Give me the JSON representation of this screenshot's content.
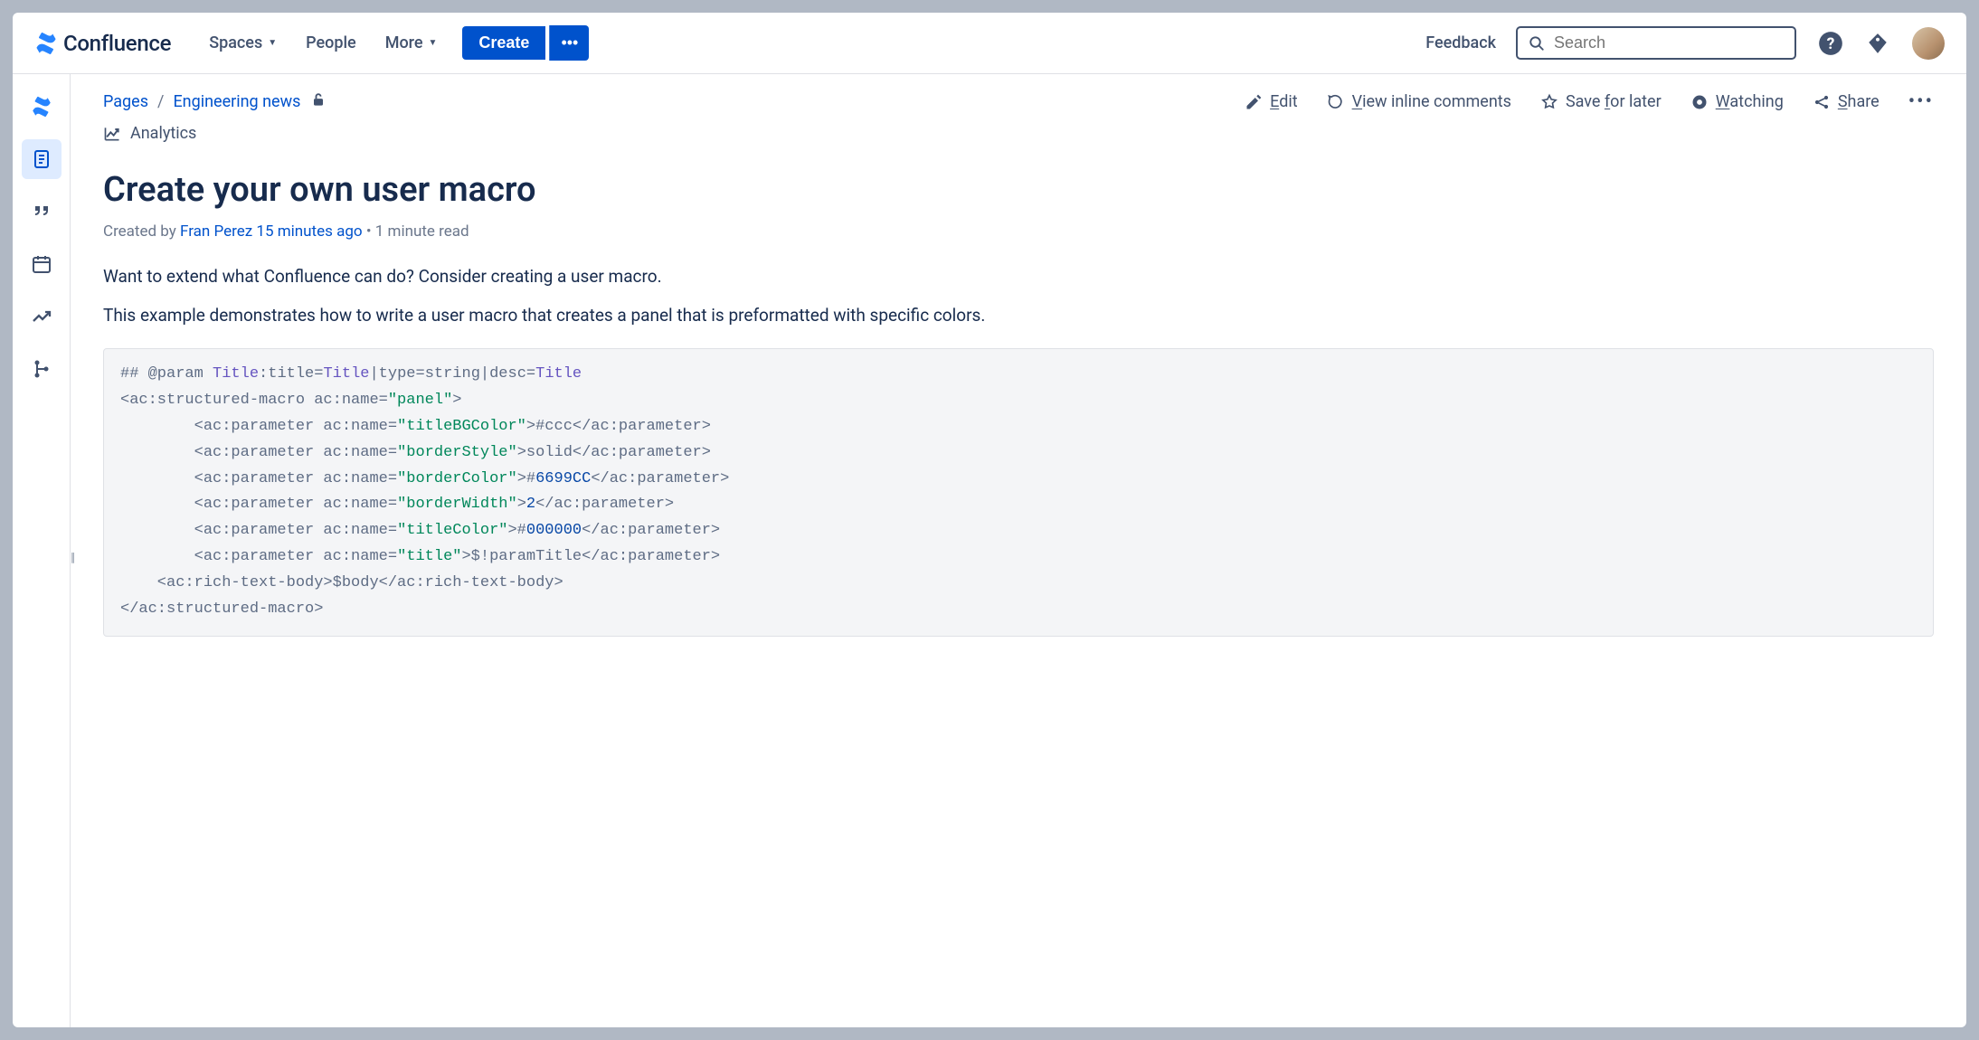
{
  "brand": {
    "name": "Confluence"
  },
  "nav": {
    "spaces": "Spaces",
    "people": "People",
    "more": "More",
    "create": "Create",
    "feedback": "Feedback",
    "search_placeholder": "Search"
  },
  "breadcrumb": {
    "pages": "Pages",
    "space": "Engineering news"
  },
  "toolbar": {
    "edit": "Edit",
    "view_inline": "View inline comments",
    "save_later": "Save for later",
    "watching": "Watching",
    "share": "Share",
    "analytics": "Analytics"
  },
  "page": {
    "title": "Create your own user macro",
    "byline_prefix": "Created by ",
    "author": "Fran Perez",
    "when": "15 minutes ago",
    "readtime": "1 minute read",
    "para1": "Want to extend what Confluence can do? Consider creating a user macro.",
    "para2": "This example demonstrates how to write a user macro that creates a panel that is preformatted with specific colors."
  },
  "code": {
    "l1_a": "## @param ",
    "l1_b": "Title",
    "l1_c": ":title=",
    "l1_d": "Title",
    "l1_e": "|type=string|desc=",
    "l1_f": "Title",
    "l2_a": "<ac:structured-macro ac:name=",
    "l2_b": "\"panel\"",
    "l2_c": ">",
    "l3_a": "        <ac:parameter ac:name=",
    "l3_b": "\"titleBGColor\"",
    "l3_c": ">#ccc</ac:parameter>",
    "l4_a": "        <ac:parameter ac:name=",
    "l4_b": "\"borderStyle\"",
    "l4_c": ">solid</ac:parameter>",
    "l5_a": "        <ac:parameter ac:name=",
    "l5_b": "\"borderColor\"",
    "l5_c": ">#",
    "l5_d": "6699CC",
    "l5_e": "</ac:parameter>",
    "l6_a": "        <ac:parameter ac:name=",
    "l6_b": "\"borderWidth\"",
    "l6_c": ">",
    "l6_d": "2",
    "l6_e": "</ac:parameter>",
    "l7_a": "        <ac:parameter ac:name=",
    "l7_b": "\"titleColor\"",
    "l7_c": ">#",
    "l7_d": "000000",
    "l7_e": "</ac:parameter>",
    "l8_a": "        <ac:parameter ac:name=",
    "l8_b": "\"title\"",
    "l8_c": ">$!paramTitle</ac:parameter>",
    "l9": "    <ac:rich-text-body>$body</ac:rich-text-body>",
    "l10": "</ac:structured-macro>"
  }
}
